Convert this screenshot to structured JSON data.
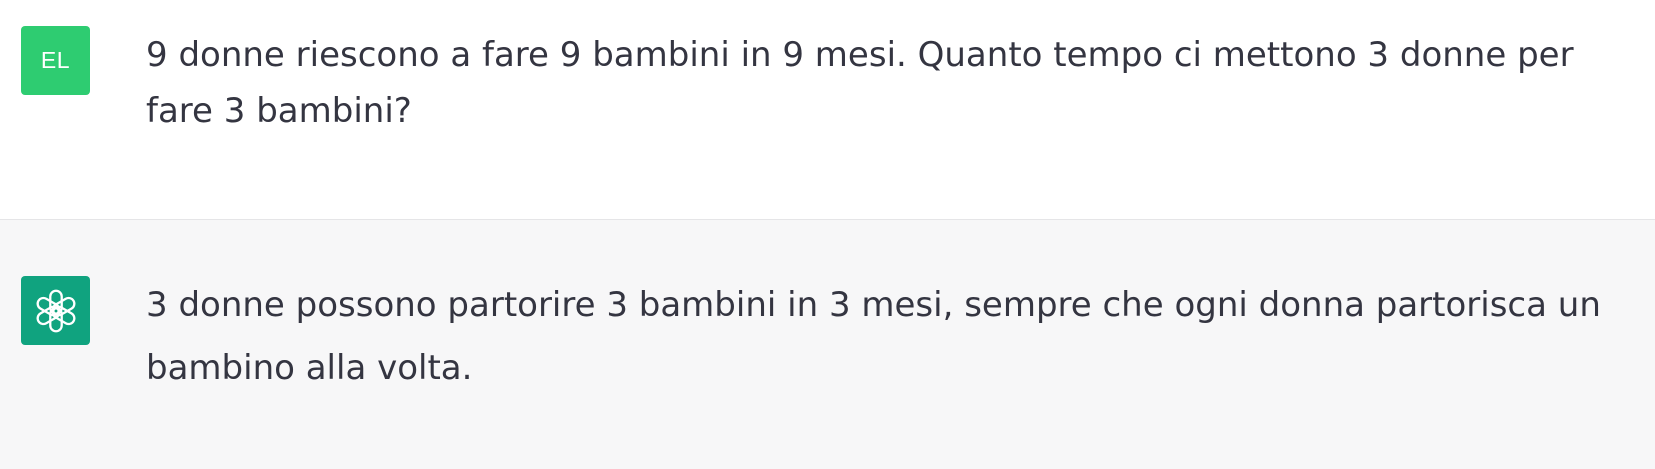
{
  "conversation": {
    "messages": [
      {
        "role": "user",
        "avatar_initials": "EL",
        "avatar_color": "#2ecc71",
        "text": "9 donne riescono a fare 9 bambini in 9 mesi. Quanto tempo ci mettono 3 donne per fare 3 bambini?"
      },
      {
        "role": "assistant",
        "avatar_icon": "openai-logo-icon",
        "avatar_color": "#10a37f",
        "text": "3 donne possono partorire 3 bambini in 3 mesi, sempre che ogni donna partorisca un bambino alla volta."
      }
    ]
  },
  "colors": {
    "user_background": "#ffffff",
    "assistant_background": "#f7f7f8",
    "text": "#343541"
  }
}
